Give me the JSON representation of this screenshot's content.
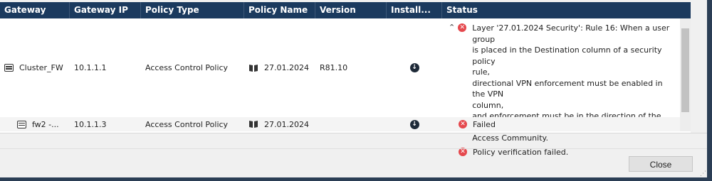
{
  "columns": {
    "gateway": "Gateway",
    "gateway_ip": "Gateway IP",
    "policy_type": "Policy Type",
    "policy_name": "Policy Name",
    "version": "Version",
    "install": "Install...",
    "status": "Status"
  },
  "rows": [
    {
      "gateway": "Cluster_FW",
      "gateway_ip": "10.1.1.1",
      "policy_type": "Access Control Policy",
      "policy_name": "27.01.2024",
      "version": "R81.10",
      "status_detail": "Layer '27.01.2024 Security': Rule 16: When a user group\nis placed in the Destination column of a security policy\nrule,\ndirectional VPN enforcement must be enabled in the VPN\ncolumn,\nand enforcement must be in the direction of the Remote\nAccess Community.",
      "status_summary": "Policy verification failed.",
      "install_icon": "download-circle",
      "status_icon": "error-circle"
    },
    {
      "gateway": "fw2 -...",
      "gateway_ip": "10.1.1.3",
      "policy_type": "Access Control Policy",
      "policy_name": "27.01.2024",
      "version": "",
      "status": "Failed",
      "install_icon": "download-circle",
      "status_icon": "error-circle"
    }
  ],
  "footer": {
    "close_label": "Close"
  },
  "colors": {
    "header_bg": "#1b3a5e",
    "error": "#e5484d"
  }
}
